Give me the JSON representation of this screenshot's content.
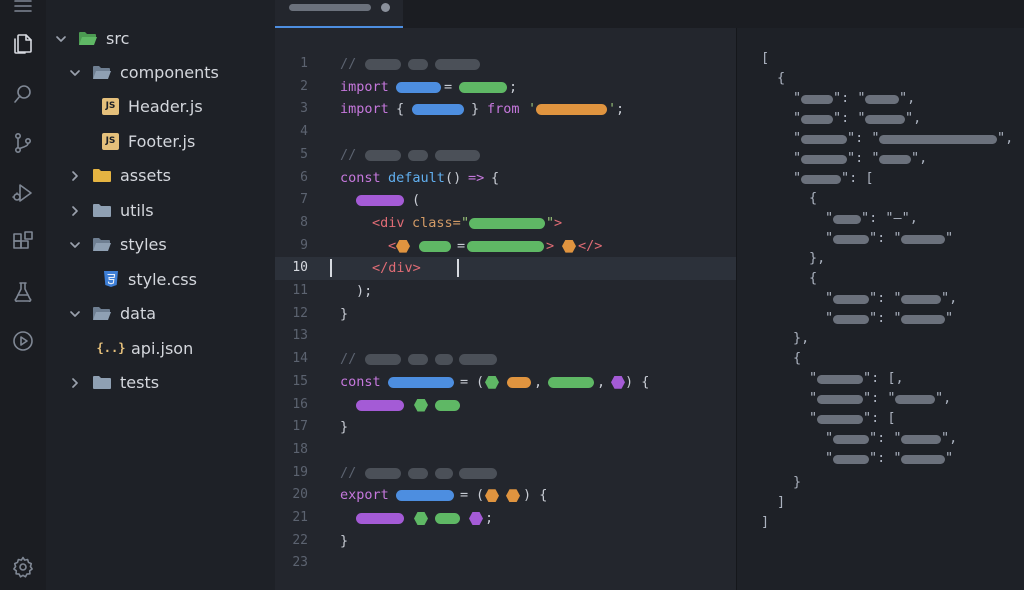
{
  "sidebar": {
    "items": [
      {
        "label": "src",
        "kind": "folder-open",
        "depth": 0,
        "icon": "folder-open-icon",
        "color": "#5fb865"
      },
      {
        "label": "components",
        "kind": "folder-open",
        "depth": 1,
        "icon": "folder-open-icon",
        "color": "#8fa0b3"
      },
      {
        "label": "Header.js",
        "kind": "js",
        "depth": 2,
        "icon": "javascript-file-icon"
      },
      {
        "label": "Footer.js",
        "kind": "js",
        "depth": 2,
        "icon": "javascript-file-icon"
      },
      {
        "label": "assets",
        "kind": "folder-closed",
        "depth": 1,
        "icon": "folder-icon",
        "color": "#e5b442"
      },
      {
        "label": "utils",
        "kind": "folder-closed",
        "depth": 1,
        "icon": "folder-icon",
        "color": "#8fa0b3"
      },
      {
        "label": "styles",
        "kind": "folder-open",
        "depth": 1,
        "icon": "folder-open-icon",
        "color": "#8fa0b3"
      },
      {
        "label": "style.css",
        "kind": "css",
        "depth": 2,
        "icon": "css-file-icon"
      },
      {
        "label": "data",
        "kind": "folder-open",
        "depth": 1,
        "icon": "folder-open-icon",
        "color": "#8fa0b3"
      },
      {
        "label": "api.json",
        "kind": "json",
        "depth": 2,
        "icon": "json-file-icon"
      },
      {
        "label": "tests",
        "kind": "folder-closed",
        "depth": 1,
        "icon": "folder-icon",
        "color": "#8fa0b3"
      }
    ]
  },
  "activity_bar": {
    "icons": [
      "hamburger-menu-icon",
      "files-explorer-icon",
      "search-icon",
      "source-control-icon",
      "run-debug-icon",
      "extensions-icon",
      "testing-flask-icon",
      "run-history-icon",
      "settings-gear-icon"
    ]
  },
  "editor": {
    "current_line": 10,
    "line_numbers": [
      "1",
      "2",
      "3",
      "4",
      "5",
      "6",
      "7",
      "8",
      "9",
      "10",
      "11",
      "12",
      "13",
      "14",
      "15",
      "16",
      "17",
      "18",
      "19",
      "20",
      "21",
      "22",
      "23"
    ],
    "code": {
      "comment_marker": "//",
      "import_kw": "import",
      "equals": "=",
      "semicolon": ";",
      "brace_open": "{",
      "brace_close": "}",
      "from_kw": "from",
      "quote": "'",
      "const_kw": "const",
      "default_kw": "default",
      "fn_parens": "()",
      "arrow": "=>",
      "paren_open": "(",
      "paren_close": ");",
      "div_open": "<div",
      "class_attr": "class=",
      "dquote": "\"",
      "gt": ">",
      "lt": "<",
      "close_tag_end": "</>",
      "div_close": "</div>",
      "comma": ",",
      "paren_brace": ") {",
      "export_kw": "export"
    },
    "colors": {
      "blue": "#4d8ee0",
      "green": "#5fb865",
      "orange": "#e0943f",
      "purple": "#a45bd6",
      "gray": "#5c6370"
    }
  },
  "json_panel": {
    "bracket_open": "[",
    "bracket_close": "]",
    "obj_open": "{",
    "obj_close": "}",
    "obj_close_comma": "},",
    "quote": "\"",
    "colon_quote": "\": \"",
    "quote_comma": "\",",
    "colon_bracket": "\": [",
    "colon_bracket_comma": "\": [,",
    "dash_value": "\": \"–\","
  }
}
